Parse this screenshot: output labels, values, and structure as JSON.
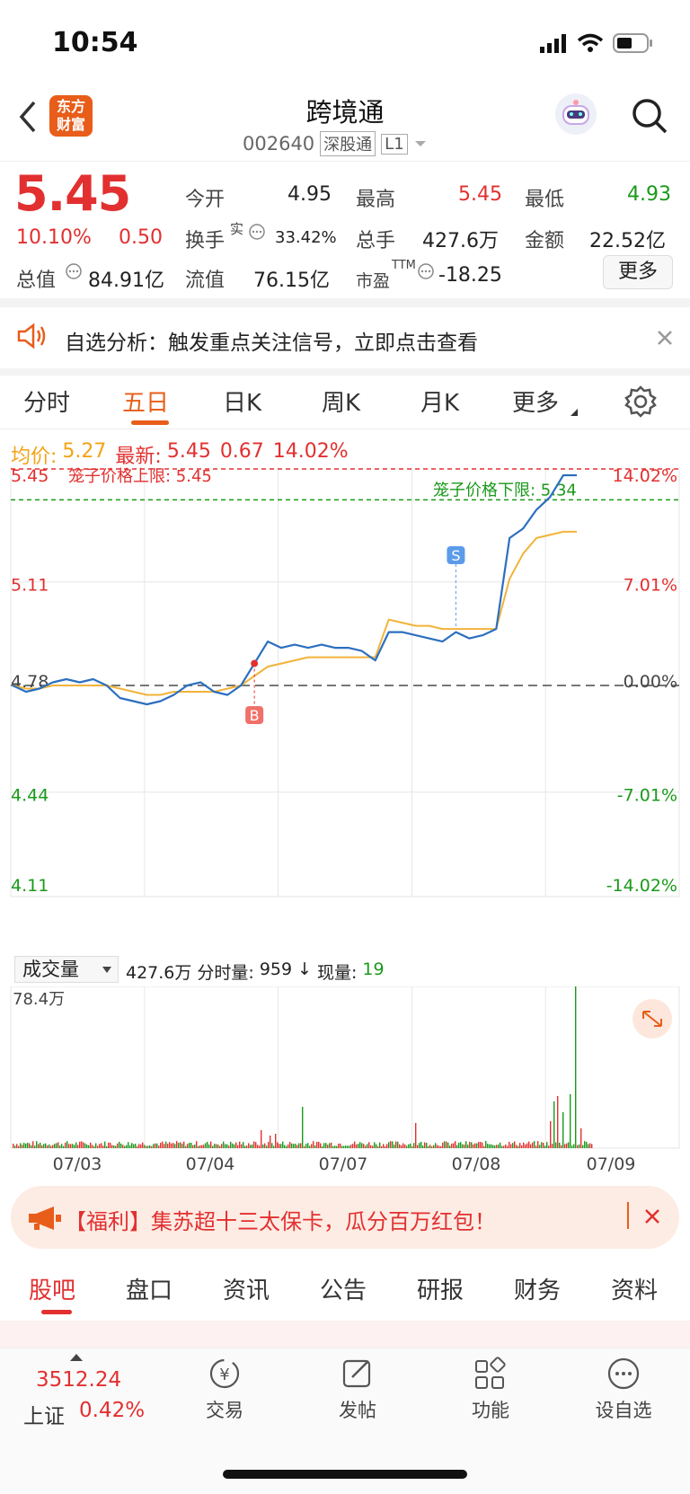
{
  "status_bar": {
    "time": "10:54"
  },
  "header": {
    "logo_text": "东方\n财富",
    "title": "跨境通",
    "code": "002640",
    "market_tag": "深股通",
    "level_tag": "L1"
  },
  "quote": {
    "price": "5.45",
    "change_pct": "10.10%",
    "change": "0.50",
    "open_label": "今开",
    "open": "4.95",
    "high_label": "最高",
    "high": "5.45",
    "low_label": "最低",
    "low": "4.93",
    "turnover_label": "换手",
    "turnover_sup": "实",
    "turnover": "33.42%",
    "volume_label": "总手",
    "volume": "427.6万",
    "amount_label": "金额",
    "amount": "22.52亿",
    "mktcap_label": "总值",
    "mktcap": "84.91亿",
    "float_label": "流值",
    "float_cap": "76.15亿",
    "pe_label": "市盈",
    "pe_sup": "TTM",
    "pe": "-18.25",
    "more_button": "更多"
  },
  "notice": {
    "text": "自选分析：触发重点关注信号，立即点击查看"
  },
  "chart_tabs": [
    {
      "label": "分时",
      "active": false
    },
    {
      "label": "五日",
      "active": true
    },
    {
      "label": "日K",
      "active": false
    },
    {
      "label": "周K",
      "active": false
    },
    {
      "label": "月K",
      "active": false
    },
    {
      "label": "更多",
      "active": false
    }
  ],
  "legend": {
    "avg_label": "均价:",
    "avg": "5.27",
    "latest_label": "最新:",
    "latest": "5.45",
    "latest_change": "0.67",
    "latest_pct": "14.02%"
  },
  "chart_annotations": {
    "upper_limit": "笼子价格上限: 5.45",
    "lower_limit": "笼子价格下限: 5.34",
    "buy_marker": "B",
    "sell_marker": "S"
  },
  "volume_header": {
    "select": "成交量",
    "total": "427.6万",
    "minute_label": "分时量:",
    "minute": "959",
    "now_label": "现量:",
    "now": "19",
    "max_label": "78.4万"
  },
  "banner": {
    "text": "【福利】集苏超十三太保卡，瓜分百万红包！"
  },
  "bottom_tabs": [
    "股吧",
    "盘口",
    "资讯",
    "公告",
    "研报",
    "财务",
    "资料"
  ],
  "bottom_bar": {
    "index_value": "3512.24",
    "index_name": "上证",
    "index_pct": "0.42%",
    "items": [
      "交易",
      "发帖",
      "功能",
      "设自选"
    ]
  },
  "colors": {
    "up": "#e23030",
    "down": "#1a9a1a",
    "accent": "#e85d1a",
    "line": "#2c6fbf",
    "avg": "#f2b33a"
  },
  "chart_data": {
    "type": "line",
    "title": "",
    "x_labels": [
      "07/03",
      "07/04",
      "07/07",
      "07/08",
      "07/09"
    ],
    "y_left_ticks": [
      "5.45",
      "5.11",
      "4.78",
      "4.44",
      "4.11"
    ],
    "y_right_ticks": [
      "14.02%",
      "7.01%",
      "0.00%",
      "-7.01%",
      "-14.02%"
    ],
    "ylim": [
      4.11,
      5.45
    ],
    "prev_close": 4.78,
    "series": [
      {
        "values": [
          4.78,
          4.76,
          4.77,
          4.79,
          4.8,
          4.79,
          4.8,
          4.78,
          4.74,
          4.73,
          4.72,
          4.73,
          4.75,
          4.78,
          4.79,
          4.76,
          4.75,
          4.78,
          4.85,
          4.92,
          4.9,
          4.91,
          4.9,
          4.91,
          4.9,
          4.9,
          4.89,
          4.86,
          4.95,
          4.95,
          4.94,
          4.93,
          4.92,
          4.95,
          4.93,
          4.94,
          4.96,
          5.25,
          5.28,
          5.34,
          5.38,
          5.45,
          5.45
        ]
      },
      {
        "values": [
          4.78,
          4.77,
          4.77,
          4.78,
          4.78,
          4.78,
          4.78,
          4.78,
          4.77,
          4.76,
          4.75,
          4.75,
          4.76,
          4.76,
          4.76,
          4.76,
          4.77,
          4.78,
          4.81,
          4.84,
          4.85,
          4.86,
          4.87,
          4.87,
          4.87,
          4.87,
          4.87,
          4.87,
          4.99,
          4.98,
          4.97,
          4.97,
          4.96,
          4.96,
          4.96,
          4.96,
          4.96,
          5.12,
          5.2,
          5.25,
          5.26,
          5.27,
          5.27
        ]
      }
    ]
  }
}
